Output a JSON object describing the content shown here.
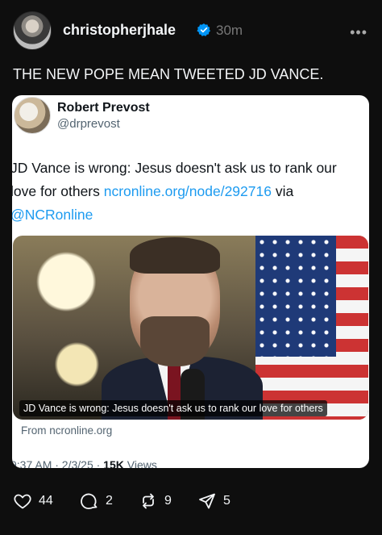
{
  "post": {
    "username": "christopherjhale",
    "timestamp": "30m",
    "text": "THE NEW POPE MEAN TWEETED JD VANCE."
  },
  "quote": {
    "name": "Robert Prevost",
    "handle": "@drprevost",
    "text_pre": "JD Vance is wrong: Jesus doesn't ask us to rank our love for others ",
    "link": "ncronline.org/node/292716",
    "text_mid": " via ",
    "mention": "@NCRonline",
    "media_caption": "JD Vance is wrong: Jesus doesn't ask us to rank our love for others",
    "source": "From ncronline.org",
    "meta_time": "9:37 AM · 2/3/25 · ",
    "views_count": "15K",
    "views_label": " Views"
  },
  "actions": {
    "likes": "44",
    "replies": "2",
    "reposts": "9",
    "shares": "5"
  },
  "colors": {
    "background": "#0e0e0e",
    "verified": "#0095f6",
    "link": "#1d9bf0"
  },
  "icons": [
    "verified-badge-icon",
    "more-options-icon",
    "heart-icon",
    "reply-icon",
    "repost-icon",
    "share-icon"
  ]
}
